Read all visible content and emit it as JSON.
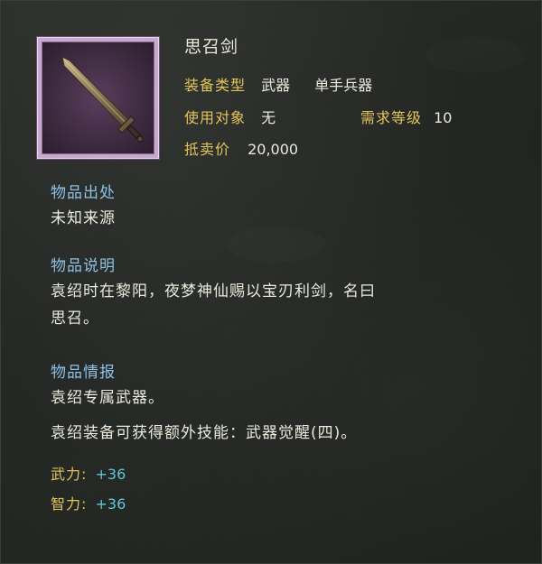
{
  "item": {
    "name": "思召剑",
    "equip_type_label": "装备类型",
    "equip_type_value": "武器",
    "equip_subtype_value": "单手兵器",
    "target_label": "使用对象",
    "target_value": "无",
    "level_label": "需求等级",
    "level_value": "10",
    "sell_label": "抵卖价",
    "sell_value": "20,000"
  },
  "source": {
    "heading": "物品出处",
    "text": "未知来源"
  },
  "description": {
    "heading": "物品说明",
    "line1": "袁绍时在黎阳，夜梦神仙赐以宝刃利剑，名曰",
    "line2": "思召。"
  },
  "intel": {
    "heading": "物品情报",
    "line1": "袁绍专属武器。",
    "line2": "袁绍装备可获得额外技能：武器觉醒(四)。"
  },
  "stats": [
    {
      "name": "武力:",
      "value": "+36"
    },
    {
      "name": "智力:",
      "value": "+36"
    }
  ],
  "icons": {
    "item_icon": "sword-icon"
  },
  "colors": {
    "label_gold": "#e2c55a",
    "heading_blue": "#8dc2e6",
    "stat_cyan": "#5fc7d6",
    "frame_purple": "#c7a8cf"
  }
}
